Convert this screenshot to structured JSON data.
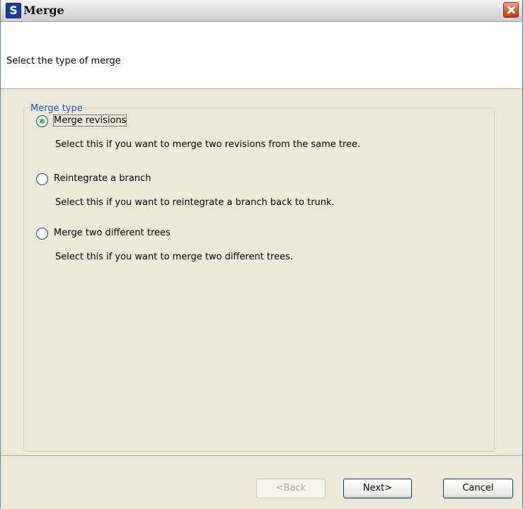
{
  "window": {
    "title": "Merge",
    "icon": "S"
  },
  "header": {
    "text": "Select the type of merge"
  },
  "merge_type": {
    "legend": "Merge type",
    "selected": "merge_revisions",
    "options": [
      {
        "id": "merge_revisions",
        "label": "Merge revisions",
        "description": "Select this if you want to merge two revisions from the same tree.",
        "checked": true
      },
      {
        "id": "reintegrate_branch",
        "label": "Reintegrate a branch",
        "description": "Select this if you want to reintegrate a branch back to trunk.",
        "checked": false
      },
      {
        "id": "merge_two_trees",
        "label": "Merge two different trees",
        "description": "Select this if you want to merge two different trees.",
        "checked": false
      }
    ]
  },
  "buttons": {
    "back": "<Back",
    "next": "Next>",
    "cancel": "Cancel"
  }
}
